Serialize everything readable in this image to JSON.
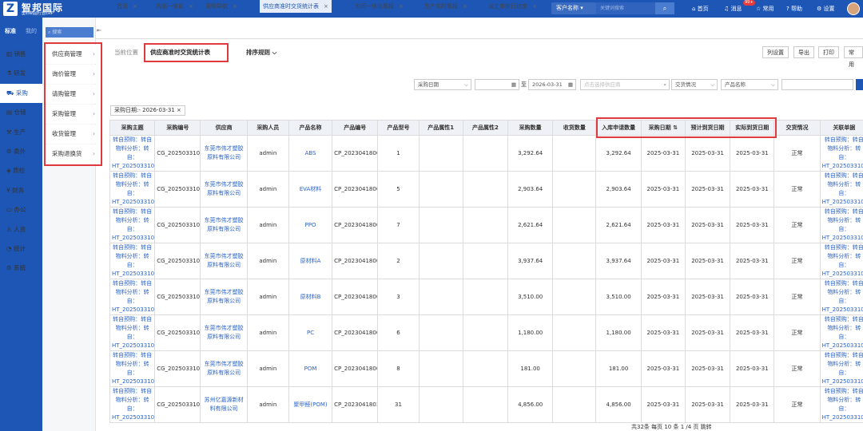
{
  "brand": {
    "title": "智邦国际",
    "subtitle": "塑料制品行业ERP",
    "logo_letter": "Z"
  },
  "topbar": {
    "customer_select": "客户名称",
    "keyword_placeholder": "关键词搜索",
    "links": [
      "首页",
      "消息",
      "常用",
      "帮助",
      "设置"
    ],
    "badge": "99+"
  },
  "leftnav": {
    "tabs": [
      "标准",
      "我的"
    ],
    "items": [
      "销售",
      "研发",
      "采购",
      "仓储",
      "生产",
      "委外",
      "质检",
      "财务",
      "办公",
      "人资",
      "统计",
      "系统"
    ],
    "active": "采购"
  },
  "subnav": {
    "search_placeholder": "搜索",
    "items": [
      "供应商管理",
      "询价管理",
      "请购管理",
      "采购管理",
      "收货管理",
      "采购退换货"
    ]
  },
  "tabs": [
    "首页",
    "内部一体化",
    "采购导航",
    "供应商准时交货统计表",
    "车间一体化看板",
    "生产实时看板",
    "派工单执行进度"
  ],
  "active_tab": "供应商准时交货统计表",
  "breadcrumb": {
    "prefix": "当前位置",
    "current": "供应商准时交货统计表"
  },
  "sort_rule": "排序规则 ⌵",
  "actions": [
    "列设置",
    "导出",
    "打印",
    "常用"
  ],
  "filters": {
    "date_type": "采购日期",
    "date_sep": "至",
    "date_to": "2026-03-31",
    "supplier_placeholder": "点击选择供应商",
    "delivery_status": "交货情况",
    "product_name": "产品名称"
  },
  "chip": "采购日期:- 2026-03-31 ×",
  "table": {
    "headers": [
      "采购主题",
      "采购编号",
      "供应商",
      "采购人员",
      "产品名称",
      "产品编号",
      "产品型号",
      "产品属性1",
      "产品属性2",
      "采购数量",
      "收货数量",
      "入库申请数量",
      "采购日期 ⇅",
      "预计到货日期",
      "实际到货日期",
      "交货情况",
      "关联单据"
    ],
    "rows": [
      [
        "转自预购：转自物料分析：转自：HT_20250331002",
        "CG_20250331002",
        "东莞市伟才塑胶原料有限公司",
        "admin",
        "ABS",
        "CP_20230418001",
        "1",
        "",
        "",
        "3,292.64",
        "",
        "3,292.64",
        "2025-03-31",
        "2025-03-31",
        "2025-03-31",
        "正常",
        "转自预购：转自物料分析：转自：HT_20250331002"
      ],
      [
        "转自预购：转自物料分析：转自：HT_20250331002",
        "CG_20250331002",
        "东莞市伟才塑胶原料有限公司",
        "admin",
        "EVA材料",
        "CP_20230418005",
        "5",
        "",
        "",
        "2,903.64",
        "",
        "2,903.64",
        "2025-03-31",
        "2025-03-31",
        "2025-03-31",
        "正常",
        "转自预购：转自物料分析：转自：HT_20250331002"
      ],
      [
        "转自预购：转自物料分析：转自：HT_20250331002",
        "CG_20250331002",
        "东莞市伟才塑胶原料有限公司",
        "admin",
        "PPO",
        "CP_20230418007",
        "7",
        "",
        "",
        "2,621.64",
        "",
        "2,621.64",
        "2025-03-31",
        "2025-03-31",
        "2025-03-31",
        "正常",
        "转自预购：转自物料分析：转自：HT_20250331002"
      ],
      [
        "转自预购：转自物料分析：转自：HT_20250331002",
        "CG_20250331002",
        "东莞市伟才塑胶原料有限公司",
        "admin",
        "原材料A",
        "CP_20230418002",
        "2",
        "",
        "",
        "3,937.64",
        "",
        "3,937.64",
        "2025-03-31",
        "2025-03-31",
        "2025-03-31",
        "正常",
        "转自预购：转自物料分析：转自：HT_20250331002"
      ],
      [
        "转自预购：转自物料分析：转自：HT_20250331002",
        "CG_20250331002",
        "东莞市伟才塑胶原料有限公司",
        "admin",
        "原材料B",
        "CP_20230418003",
        "3",
        "",
        "",
        "3,510.00",
        "",
        "3,510.00",
        "2025-03-31",
        "2025-03-31",
        "2025-03-31",
        "正常",
        "转自预购：转自物料分析：转自：HT_20250331002"
      ],
      [
        "转自预购：转自物料分析：转自：HT_20250331002",
        "CG_20250331002",
        "东莞市伟才塑胶原料有限公司",
        "admin",
        "PC",
        "CP_20230418006",
        "6",
        "",
        "",
        "1,180.00",
        "",
        "1,180.00",
        "2025-03-31",
        "2025-03-31",
        "2025-03-31",
        "正常",
        "转自预购：转自物料分析：转自：HT_20250331002"
      ],
      [
        "转自预购：转自物料分析：转自：HT_20250331002",
        "CG_20250331002",
        "东莞市伟才塑胶原料有限公司",
        "admin",
        "POM",
        "CP_20230418008",
        "8",
        "",
        "",
        "181.00",
        "",
        "181.00",
        "2025-03-31",
        "2025-03-31",
        "2025-03-31",
        "正常",
        "转自预购：转自物料分析：转自：HT_20250331002"
      ],
      [
        "转自预购：转自物料分析：转自：HT_20250331001",
        "CG_20250331001",
        "苏州亿嘉源新材料有限公司",
        "admin",
        "聚甲醛(POM)",
        "CP_20230418031",
        "31",
        "",
        "",
        "4,856.00",
        "",
        "4,856.00",
        "2025-03-31",
        "2025-03-31",
        "2025-03-31",
        "正常",
        "转自预购：转自物料分析：转自：HT_20250331001"
      ]
    ]
  },
  "pager": "共32条  每页 10 条  1 /4 页  跳转"
}
